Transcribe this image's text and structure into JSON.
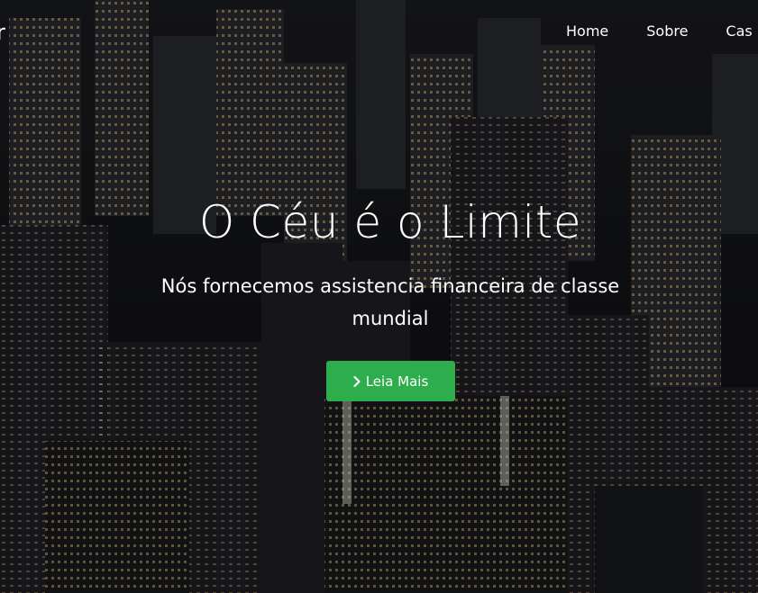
{
  "navbar": {
    "brand_fragment": "r",
    "items": [
      {
        "label": "Home"
      },
      {
        "label": "Sobre"
      },
      {
        "label": "Cas"
      }
    ]
  },
  "hero": {
    "headline": "O Céu é o Limite",
    "subtitle": "Nós fornecemos assistencia financeira de classe mundial",
    "cta_label": "Leia Mais",
    "cta_icon": "chevron-right-icon",
    "cta_color": "#2dad4b"
  }
}
